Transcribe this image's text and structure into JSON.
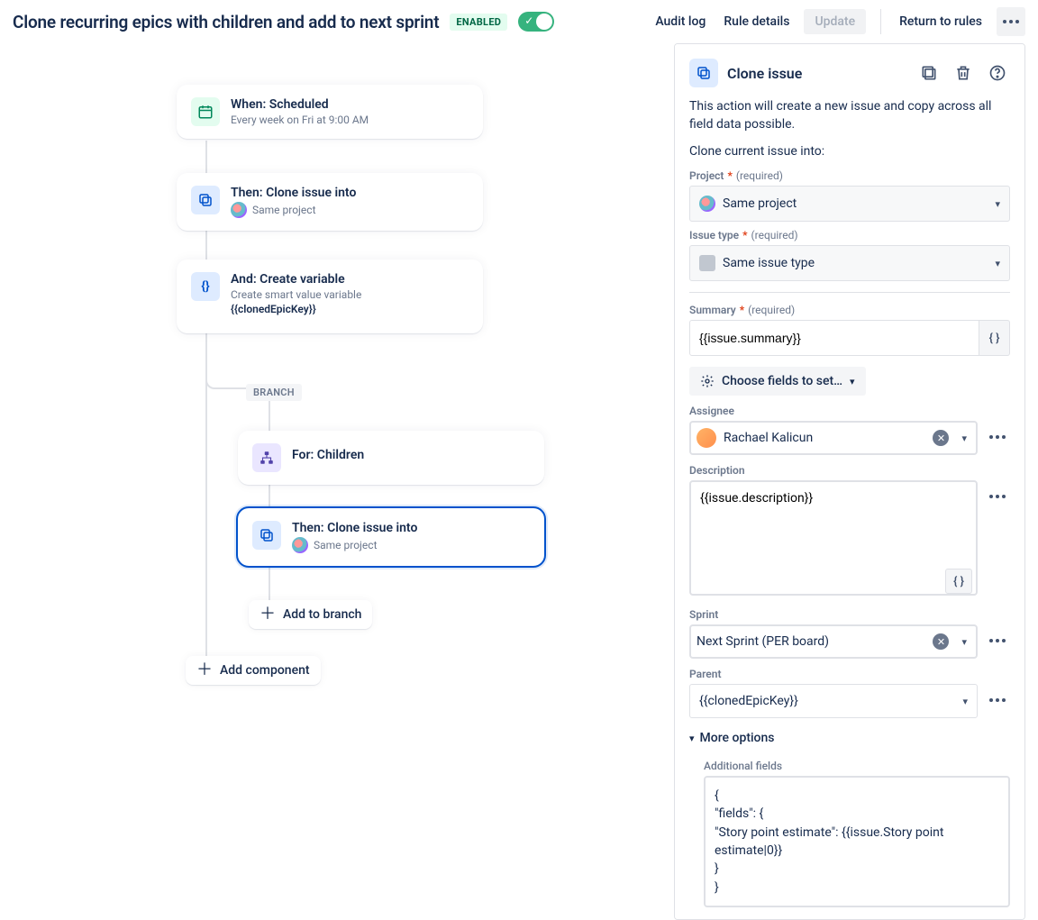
{
  "header": {
    "title": "Clone recurring epics with children and add to next sprint",
    "enabled_badge": "ENABLED",
    "audit_log": "Audit log",
    "rule_details": "Rule details",
    "update": "Update",
    "return": "Return to rules"
  },
  "flow": {
    "trigger": {
      "title": "When: Scheduled",
      "sub": "Every week on Fri at 9:00 AM"
    },
    "step1": {
      "title": "Then: Clone issue into",
      "sub": "Same project"
    },
    "step2": {
      "title": "And: Create variable",
      "sub1": "Create smart value variable",
      "sub2": "{{clonedEpicKey}}"
    },
    "branch_label": "BRANCH",
    "branch_for": {
      "title": "For: Children"
    },
    "branch_step": {
      "title": "Then: Clone issue into",
      "sub": "Same project"
    },
    "add_to_branch": "Add to branch",
    "add_component": "Add component"
  },
  "panel": {
    "title": "Clone issue",
    "desc": "This action will create a new issue and copy across all field data possible.",
    "clone_into": "Clone current issue into:",
    "project_label": "Project",
    "required": "(required)",
    "project_value": "Same project",
    "issuetype_label": "Issue type",
    "issuetype_value": "Same issue type",
    "summary_label": "Summary",
    "summary_value": "{{issue.summary}}",
    "choose_fields": "Choose fields to set…",
    "assignee_label": "Assignee",
    "assignee_value": "Rachael Kalicun",
    "description_label": "Description",
    "description_value": "{{issue.description}}",
    "sprint_label": "Sprint",
    "sprint_value": "Next Sprint (PER board)",
    "parent_label": "Parent",
    "parent_value": "{{clonedEpicKey}}",
    "more_options": "More options",
    "additional_fields_label": "Additional fields",
    "additional_fields_value": "{\n\"fields\": {\n\"Story point estimate\": {{issue.Story point estimate|0}}\n}\n}"
  }
}
